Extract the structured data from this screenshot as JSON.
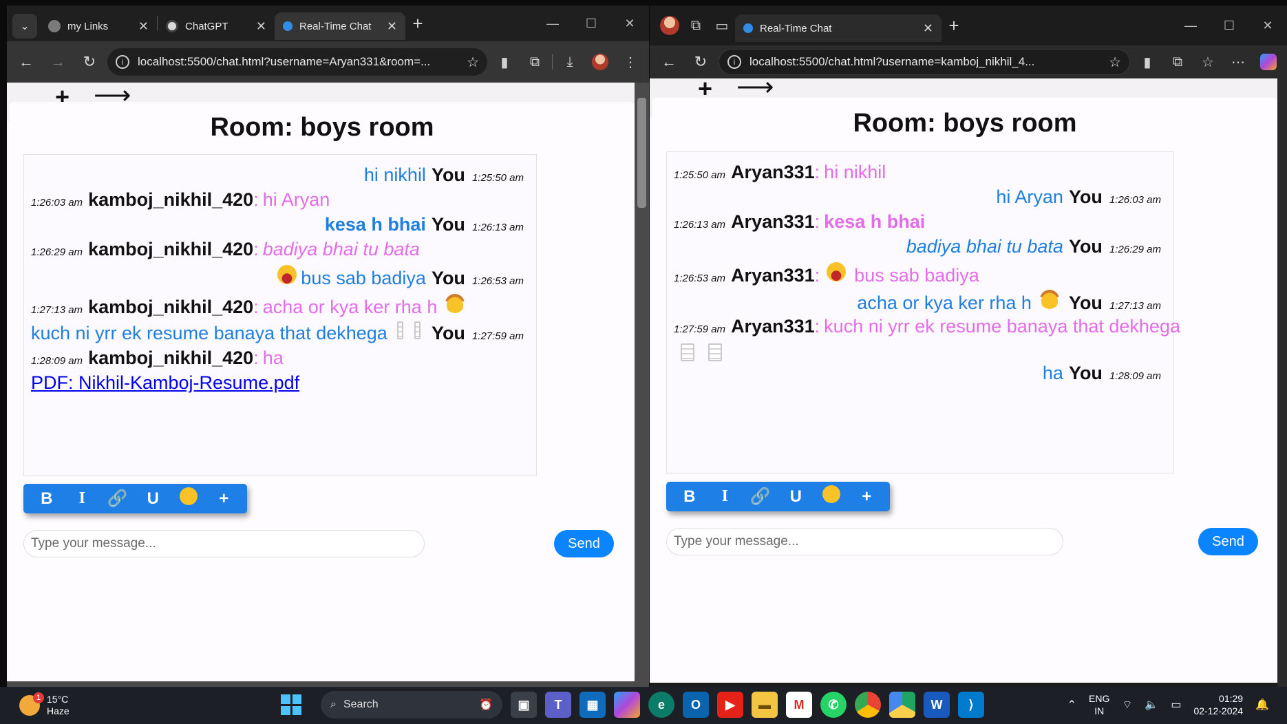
{
  "left_window": {
    "tabs": [
      {
        "title": "my Links"
      },
      {
        "title": "ChatGPT"
      },
      {
        "title": "Real-Time Chat"
      }
    ],
    "url": "localhost:5500/chat.html?username=Aryan331&room=...",
    "room_title": "Room: boys room",
    "messages": [
      {
        "side": "right",
        "text": "hi nikhil",
        "you": "You",
        "time": "1:25:50 am"
      },
      {
        "side": "left",
        "time": "1:26:03 am",
        "user": "kamboj_nikhil_420",
        "sep": ":",
        "text": "hi Aryan"
      },
      {
        "side": "right",
        "text": "kesa h bhai",
        "you": "You",
        "time": "1:26:13 am"
      },
      {
        "side": "left",
        "time": "1:26:29 am",
        "user": "kamboj_nikhil_420",
        "sep": ":",
        "text": "badiya bhai tu bata"
      },
      {
        "side": "right",
        "text": "bus sab badiya",
        "you": "You",
        "time": "1:26:53 am"
      },
      {
        "side": "left",
        "time": "1:27:13 am",
        "user": "kamboj_nikhil_420",
        "sep": ":",
        "text": "acha or kya ker rha h"
      },
      {
        "side": "right",
        "text": "kuch ni yrr ek resume banaya that dekhega",
        "you": "You",
        "time": "1:27:59 am"
      },
      {
        "side": "left",
        "time": "1:28:09 am",
        "user": "kamboj_nikhil_420",
        "sep": ":",
        "text": "ha"
      }
    ],
    "pdf_link": "PDF: Nikhil-Kamboj-Resume.pdf",
    "input_placeholder": "Type your message...",
    "send_label": "Send"
  },
  "right_window": {
    "tabs": [
      {
        "title": "Real-Time Chat"
      }
    ],
    "url": "localhost:5500/chat.html?username=kamboj_nikhil_4...",
    "room_title": "Room: boys room",
    "messages": [
      {
        "side": "left",
        "time": "1:25:50 am",
        "user": "Aryan331",
        "sep": ":",
        "text": "hi nikhil"
      },
      {
        "side": "right",
        "text": "hi Aryan",
        "you": "You",
        "time": "1:26:03 am"
      },
      {
        "side": "left",
        "time": "1:26:13 am",
        "user": "Aryan331",
        "sep": ":",
        "text": "kesa h bhai"
      },
      {
        "side": "right",
        "text": "badiya bhai tu bata",
        "you": "You",
        "time": "1:26:29 am"
      },
      {
        "side": "left",
        "time": "1:26:53 am",
        "user": "Aryan331",
        "sep": ":",
        "text": "bus sab badiya"
      },
      {
        "side": "right",
        "text": "acha or kya ker rha h",
        "you": "You",
        "time": "1:27:13 am"
      },
      {
        "side": "left",
        "time": "1:27:59 am",
        "user": "Aryan331",
        "sep": ":",
        "text": "kuch ni yrr ek resume banaya that dekhega"
      },
      {
        "side": "right",
        "text": "ha",
        "you": "You",
        "time": "1:28:09 am"
      }
    ],
    "input_placeholder": "Type your message...",
    "send_label": "Send"
  },
  "format_toolbar": {
    "bold": "B",
    "italic": "I",
    "underline": "U",
    "plus": "+",
    "icons": [
      "link-icon",
      "smiley-icon"
    ]
  },
  "page_top": {
    "plus": "+",
    "arrow": "⟶"
  },
  "taskbar": {
    "weather_temp": "15°C",
    "weather_desc": "Haze",
    "weather_badge": "1",
    "search_label": "Search",
    "lang_line1": "ENG",
    "lang_line2": "IN",
    "time": "01:29",
    "date": "02-12-2024"
  },
  "colors": {
    "accent_blue": "#1e7fe7",
    "send_blue": "#0a84ff",
    "other_user_text": "#e56ce9",
    "own_text": "#1e7fe0"
  }
}
